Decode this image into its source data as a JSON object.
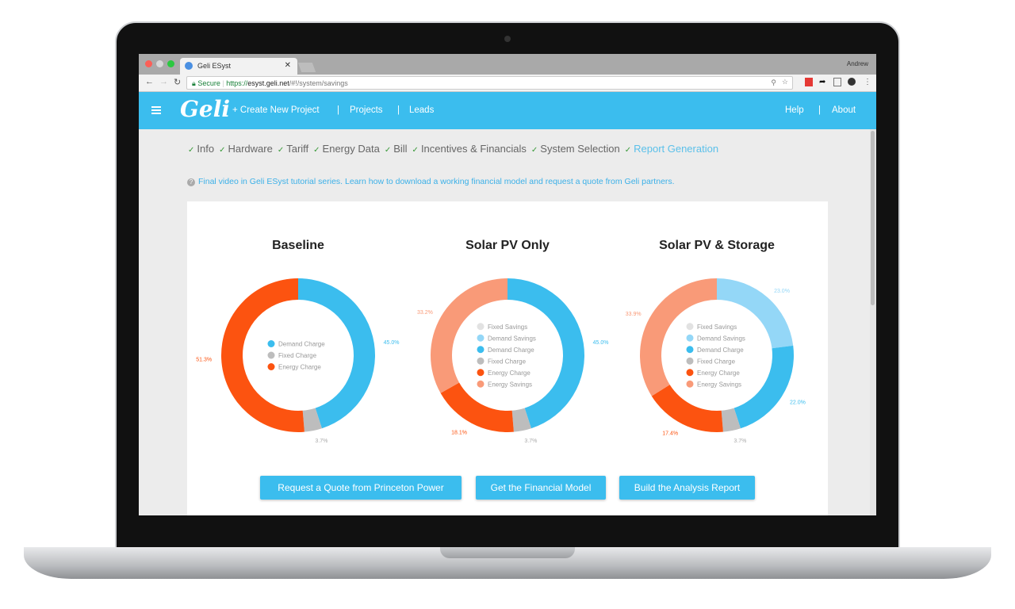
{
  "browser": {
    "tab_title": "Geli ESyst",
    "user": "Andrew",
    "secure_label": "Secure",
    "url_scheme": "https://",
    "url_host": "esyst.geli.net",
    "url_path": "/#!/system/savings"
  },
  "header": {
    "logo": "Geli",
    "nav": [
      "+ Create New Project",
      "Projects",
      "Leads"
    ],
    "right": [
      "Help",
      "About"
    ],
    "separator": "|"
  },
  "steps": [
    {
      "label": "Info"
    },
    {
      "label": "Hardware"
    },
    {
      "label": "Tariff"
    },
    {
      "label": "Energy Data"
    },
    {
      "label": "Bill"
    },
    {
      "label": "Incentives & Financials"
    },
    {
      "label": "System Selection"
    },
    {
      "label": "Report Generation",
      "active": true
    }
  ],
  "step_check": "✓",
  "tip": "Final video in Geli ESyst tutorial series. Learn how to download a working financial model and request a quote from Geli partners.",
  "tip_icon": "?",
  "colors": {
    "Demand Charge": "#3bbdee",
    "Fixed Charge": "#bdbdbd",
    "Energy Charge": "#fc5310",
    "Fixed Savings": "#e2e2e2",
    "Demand Savings": "#94d7f7",
    "Energy Savings": "#f99a78",
    "accent": "#3bbdee"
  },
  "chart_data": [
    {
      "type": "pie",
      "title": "Baseline",
      "legend": [
        "Demand Charge",
        "Fixed Charge",
        "Energy Charge"
      ],
      "slices": [
        {
          "name": "Demand Charge",
          "value": 45.0,
          "label": "45.0%"
        },
        {
          "name": "Fixed Charge",
          "value": 3.7,
          "label": "3.7%"
        },
        {
          "name": "Energy Charge",
          "value": 51.3,
          "label": "51.3%"
        }
      ]
    },
    {
      "type": "pie",
      "title": "Solar PV Only",
      "legend": [
        "Fixed Savings",
        "Demand Savings",
        "Demand Charge",
        "Fixed Charge",
        "Energy Charge",
        "Energy Savings"
      ],
      "slices": [
        {
          "name": "Demand Charge",
          "value": 45.0,
          "label": "45.0%"
        },
        {
          "name": "Fixed Charge",
          "value": 3.7,
          "label": "3.7%"
        },
        {
          "name": "Energy Charge",
          "value": 18.1,
          "label": "18.1%"
        },
        {
          "name": "Energy Savings",
          "value": 33.2,
          "label": "33.2%"
        }
      ]
    },
    {
      "type": "pie",
      "title": "Solar PV & Storage",
      "legend": [
        "Fixed Savings",
        "Demand Savings",
        "Demand Charge",
        "Fixed Charge",
        "Energy Charge",
        "Energy Savings"
      ],
      "slices": [
        {
          "name": "Demand Savings",
          "value": 23.0,
          "label": "23.0%"
        },
        {
          "name": "Demand Charge",
          "value": 22.0,
          "label": "22.0%"
        },
        {
          "name": "Fixed Charge",
          "value": 3.7,
          "label": "3.7%"
        },
        {
          "name": "Energy Charge",
          "value": 17.4,
          "label": "17.4%"
        },
        {
          "name": "Energy Savings",
          "value": 33.9,
          "label": "33.9%"
        }
      ]
    }
  ],
  "buttons": [
    "Request a Quote from Princeton Power",
    "Get the Financial Model",
    "Build the Analysis Report"
  ]
}
